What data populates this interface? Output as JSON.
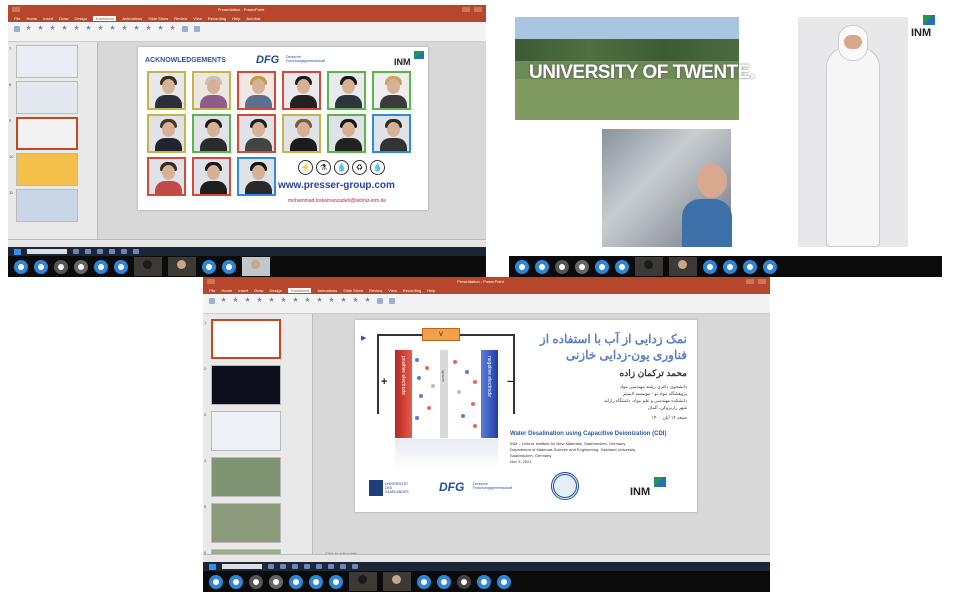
{
  "shot1": {
    "window_title": "Presentation - PowerPoint",
    "menu": [
      "File",
      "Home",
      "Insert",
      "Draw",
      "Design",
      "Transitions",
      "Animations",
      "Slide Show",
      "Review",
      "View",
      "Recording",
      "Help",
      "Acrobat"
    ],
    "active_menu": "Transitions",
    "slide_numbers": [
      "7",
      "8",
      "9",
      "10",
      "11"
    ],
    "notes_placeholder": "Click to add notes",
    "slide": {
      "title": "ACKNOWLEDGEMENTS",
      "dfg": "DFG",
      "dfg_sub": "Deutsche Forschungsgemeinschaft",
      "inm": "INM",
      "url": "www.presser-group.com",
      "email": "mohammad.torkamanzadeh@leibniz-inm.de",
      "icons": [
        "⚡",
        "⚗",
        "💧",
        "♻",
        "💧"
      ]
    }
  },
  "shot2": {
    "university_text": "UNIVERSITY OF TWENTE.",
    "inm": "INM"
  },
  "shot3": {
    "window_title": "Presentation - PowerPoint",
    "menu": [
      "File",
      "Home",
      "Insert",
      "Draw",
      "Design",
      "Transitions",
      "Animations",
      "Slide Show",
      "Review",
      "View",
      "Recording",
      "Help"
    ],
    "active_menu": "Transitions",
    "notes_placeholder": "Click to add notes",
    "slide_numbers": [
      "1",
      "2",
      "3",
      "4",
      "5",
      "6"
    ],
    "slide": {
      "voltage_label": "V",
      "positive_electrode": "positive electrode",
      "negative_electrode": "negative electrode",
      "spacer": "spacer",
      "plus": "+",
      "minus": "−",
      "title_fa_1": "نمک زدایی از آب با استفاده از",
      "title_fa_2": "فناوری یون-زدایی خازنی",
      "author_fa": "محمد ترکمان زاده",
      "lines_fa": [
        "دانشجوی دکتری رشته مهندسی مواد",
        "پژوهشگاه مواد نو - موسسه لایبنیتز",
        "دانشکده مهندسی و علم مواد، دانشگاه زارلند",
        "شهر زاربروکن، آلمان"
      ],
      "date_fa": "جمعه ۱۴ آبان ۱۴۰۰",
      "title_en": "Water Desalination using Capacitive Deionization (CDI)",
      "lines_en": [
        "INM – Leibniz Institute for New Materials, Saarbrücken, Germany",
        "Department of Materials Science and Engineering, Saarland University,",
        "Saarbrücken, Germany",
        "Nov 5, 2021"
      ],
      "logo_uds": "UNIVERSITÄT DES SAARLANDES",
      "dfg": "DFG",
      "dfg_sub": "Deutsche Forschungsgemeinschaft",
      "inm": "INM"
    }
  },
  "colors": {
    "ppt_red": "#b7472a",
    "accent_blue": "#2a58a8",
    "positive_red": "#d63a2e",
    "negative_blue": "#2d55c8",
    "teams_avatar": "#2f86d6"
  }
}
